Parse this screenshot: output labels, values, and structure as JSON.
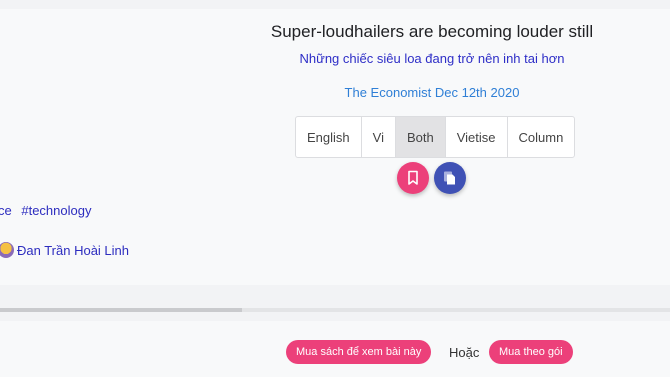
{
  "article": {
    "title": "Super-loudhailers are becoming louder still",
    "subtitle": "Những chiếc siêu loa đang trở nên inh tai hơn",
    "source": "The Economist Dec 12th 2020"
  },
  "language_toggle": {
    "options": [
      "English",
      "Vi",
      "Both",
      "Vietise",
      "Column"
    ],
    "selected": "Both"
  },
  "actions": {
    "bookmark_icon": "bookmark-icon",
    "copy_icon": "copy-icon",
    "bookmark_color": "#ec407a",
    "copy_color": "#3f51b5"
  },
  "tags": [
    "ce",
    "#technology"
  ],
  "author": {
    "name": "Đan Trần Hoài Linh"
  },
  "purchase": {
    "buy_book_label": "Mua sách để xem bài này",
    "or_label": "Hoặc",
    "subscribe_label": "Mua theo gói",
    "accent": "#ec407a"
  }
}
